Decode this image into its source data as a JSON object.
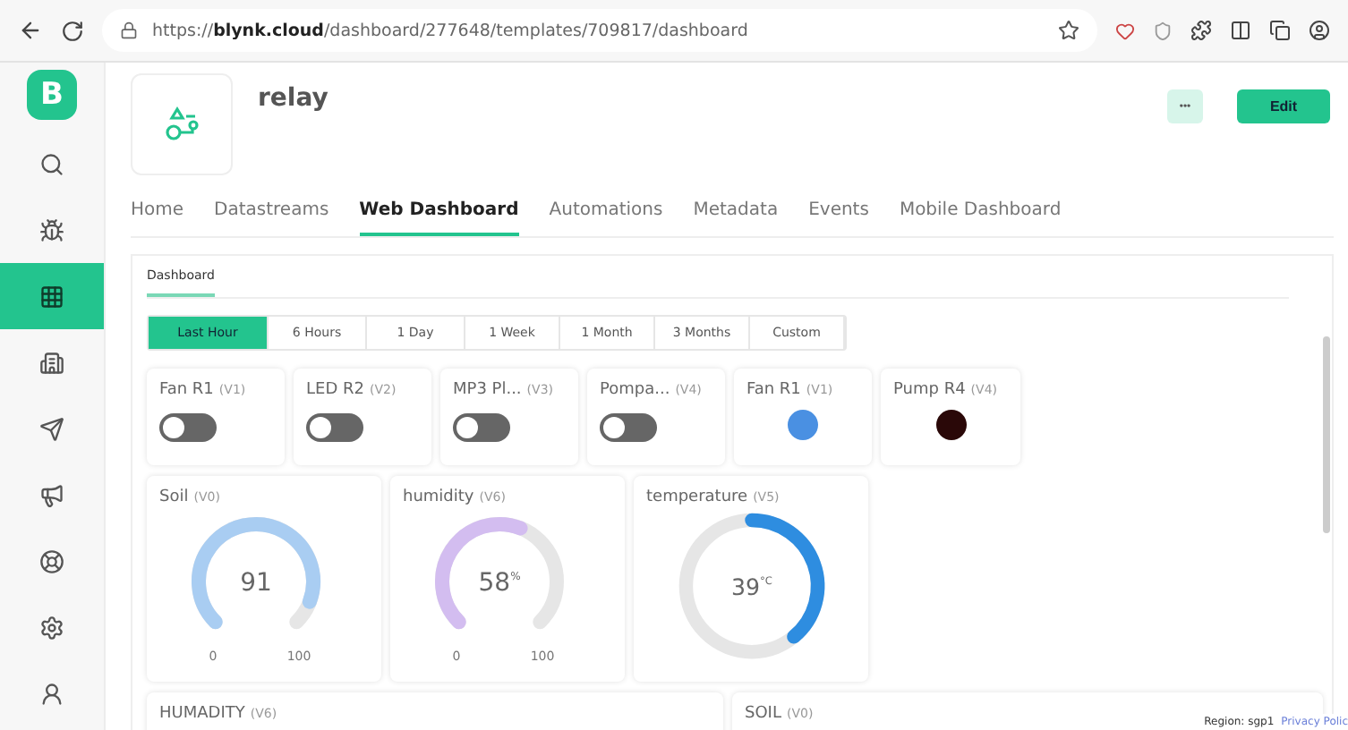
{
  "browser": {
    "url": "https://**blynk.cloud**/dashboard/277648/templates/709817/dashboard"
  },
  "sidebar": {
    "logo": "B",
    "items": [
      {
        "selected": false
      },
      {
        "selected": false
      },
      {
        "selected": true
      },
      {
        "selected": false
      },
      {
        "selected": false
      },
      {
        "selected": false
      },
      {
        "selected": false
      },
      {
        "selected": false
      },
      {
        "selected": false
      }
    ]
  },
  "header": {
    "title": "relay",
    "more_button": "•••",
    "edit_button": "Edit"
  },
  "tabs": [
    {
      "label": "Home",
      "selected": false
    },
    {
      "label": "Datastreams",
      "selected": false
    },
    {
      "label": "Web Dashboard",
      "selected": true
    },
    {
      "label": "Automations",
      "selected": false
    },
    {
      "label": "Metadata",
      "selected": false
    },
    {
      "label": "Events",
      "selected": false
    },
    {
      "label": "Mobile Dashboard",
      "selected": false
    }
  ],
  "subtabs": [
    {
      "label": "Dashboard",
      "selected": true
    }
  ],
  "time_ranges": [
    {
      "label": "Last Hour",
      "selected": true
    },
    {
      "label": "6 Hours",
      "selected": false
    },
    {
      "label": "1 Day",
      "selected": false
    },
    {
      "label": "1 Week",
      "selected": false
    },
    {
      "label": "1 Month",
      "selected": false
    },
    {
      "label": "3 Months",
      "selected": false
    },
    {
      "label": "Custom",
      "selected": false
    }
  ],
  "controls": [
    {
      "kind": "switch",
      "name": "Fan R1",
      "pin": "(V1)",
      "on": false
    },
    {
      "kind": "switch",
      "name": "LED R2",
      "pin": "(V2)",
      "on": false
    },
    {
      "kind": "switch",
      "name": "MP3 Pl...",
      "pin": "(V3)",
      "on": false
    },
    {
      "kind": "switch",
      "name": "Pompa...",
      "pin": "(V4)",
      "on": false
    },
    {
      "kind": "led",
      "name": "Fan R1",
      "pin": "(V1)",
      "color": "#4a90e2"
    },
    {
      "kind": "led",
      "name": "Pump R4",
      "pin": "(V4)",
      "color": "#2a0808"
    }
  ],
  "gauges": [
    {
      "kind": "gauge",
      "name": "Soil",
      "pin": "(V0)",
      "value": "91",
      "color": "#a9cdf2",
      "min": "0",
      "max": "100"
    },
    {
      "kind": "gauge",
      "name": "humidity",
      "pin": "(V6)",
      "value": "58",
      "unit": "%",
      "color": "#d3bdf0",
      "min": "0",
      "max": "100"
    },
    {
      "kind": "donut",
      "name": "temperature",
      "pin": "(V5)",
      "value": "39",
      "unit": "°C",
      "color": "#2e8de0"
    }
  ],
  "charts": [
    {
      "name": "HUMADITY",
      "pin": "(V6)"
    },
    {
      "name": "SOIL",
      "pin": "(V0)"
    }
  ],
  "footer": {
    "region": "Region: sgp1",
    "privacy": "Privacy Polic"
  }
}
